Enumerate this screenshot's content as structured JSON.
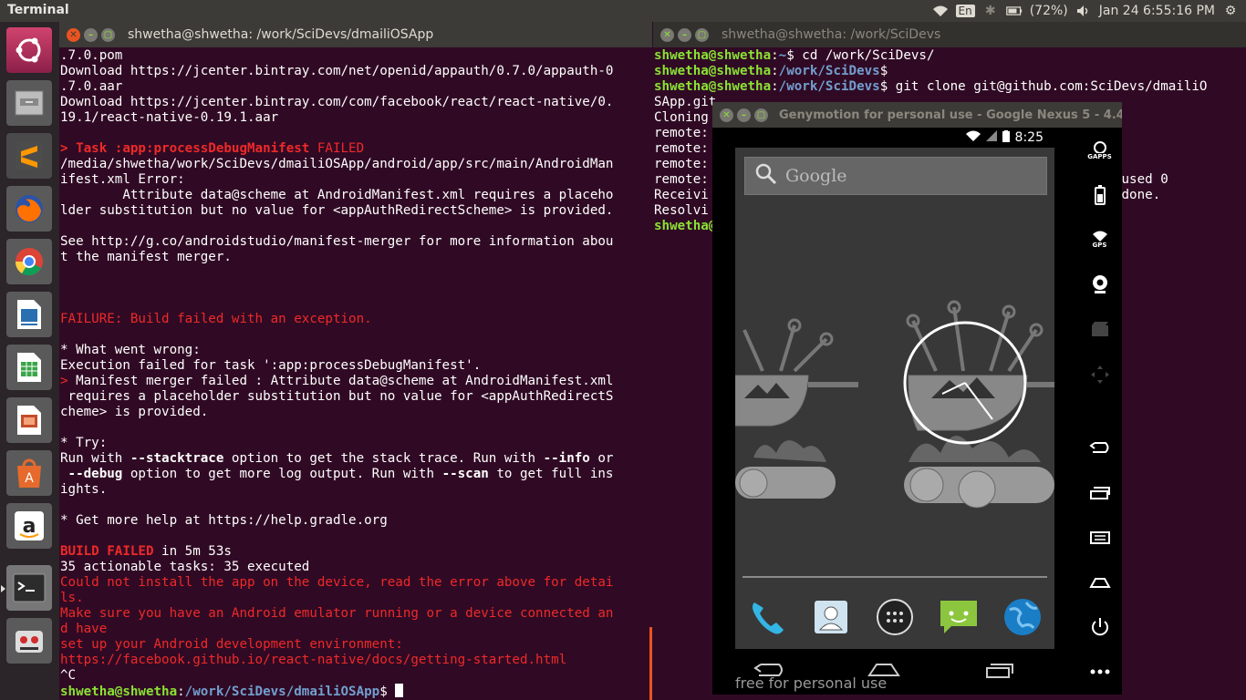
{
  "topbar": {
    "app_title": "Terminal",
    "lang": "En",
    "battery": "(72%)",
    "datetime": "Jan 24  6:55:16 PM"
  },
  "launcher": {
    "items": [
      {
        "name": "ubuntu-dash-icon",
        "color": "#c0335f"
      },
      {
        "name": "files-icon",
        "color": "#8a8a8a"
      },
      {
        "name": "sublime-text-icon",
        "color": "#3e3e3e"
      },
      {
        "name": "firefox-icon",
        "color": "#e66000"
      },
      {
        "name": "chrome-icon",
        "color": "#4285f4"
      },
      {
        "name": "libreoffice-writer-icon",
        "color": "#2a6fb0"
      },
      {
        "name": "libreoffice-calc-icon",
        "color": "#3aa548"
      },
      {
        "name": "libreoffice-impress-icon",
        "color": "#c44d2a"
      },
      {
        "name": "software-center-icon",
        "color": "#e66a2c"
      },
      {
        "name": "amazon-icon",
        "color": "#ffffff"
      },
      {
        "name": "terminal-icon",
        "color": "#2c2c2c"
      },
      {
        "name": "genymotion-icon",
        "color": "#d02c2c"
      }
    ]
  },
  "left_terminal": {
    "title": "shwetha@shwetha: /work/SciDevs/dmailiOSApp",
    "lines": [
      [
        {
          "c": "w",
          "t": ".7.0.pom"
        }
      ],
      [
        {
          "c": "w",
          "t": "Download https://jcenter.bintray.com/net/openid/appauth/0.7.0/appauth-0"
        }
      ],
      [
        {
          "c": "w",
          "t": ".7.0.aar"
        }
      ],
      [
        {
          "c": "w",
          "t": "Download https://jcenter.bintray.com/com/facebook/react/react-native/0."
        }
      ],
      [
        {
          "c": "w",
          "t": "19.1/react-native-0.19.1.aar"
        }
      ],
      [
        {
          "c": "w",
          "t": ""
        }
      ],
      [
        {
          "c": "rb",
          "t": "> Task :app:processDebugManifest"
        },
        {
          "c": "r",
          "t": " FAILED"
        }
      ],
      [
        {
          "c": "w",
          "t": "/media/shwetha/work/SciDevs/dmailiOSApp/android/app/src/main/AndroidMan"
        }
      ],
      [
        {
          "c": "w",
          "t": "ifest.xml Error:"
        }
      ],
      [
        {
          "c": "w",
          "t": "        Attribute data@scheme at AndroidManifest.xml requires a placeho"
        }
      ],
      [
        {
          "c": "w",
          "t": "lder substitution but no value for <appAuthRedirectScheme> is provided."
        }
      ],
      [
        {
          "c": "w",
          "t": ""
        }
      ],
      [
        {
          "c": "w",
          "t": "See http://g.co/androidstudio/manifest-merger for more information abou"
        }
      ],
      [
        {
          "c": "w",
          "t": "t the manifest merger."
        }
      ],
      [
        {
          "c": "w",
          "t": ""
        }
      ],
      [
        {
          "c": "w",
          "t": ""
        }
      ],
      [
        {
          "c": "w",
          "t": ""
        }
      ],
      [
        {
          "c": "r",
          "t": "FAILURE: Build failed with an exception."
        }
      ],
      [
        {
          "c": "w",
          "t": ""
        }
      ],
      [
        {
          "c": "w",
          "t": "* What went wrong:"
        }
      ],
      [
        {
          "c": "w",
          "t": "Execution failed for task ':app:processDebugManifest'."
        }
      ],
      [
        {
          "c": "r",
          "t": ">"
        },
        {
          "c": "w",
          "t": " Manifest merger failed : Attribute data@scheme at AndroidManifest.xml"
        }
      ],
      [
        {
          "c": "w",
          "t": " requires a placeholder substitution but no value for <appAuthRedirectS"
        }
      ],
      [
        {
          "c": "w",
          "t": "cheme> is provided."
        }
      ],
      [
        {
          "c": "w",
          "t": ""
        }
      ],
      [
        {
          "c": "w",
          "t": "* Try:"
        }
      ],
      [
        {
          "c": "w",
          "t": "Run with "
        },
        {
          "c": "bw",
          "t": "--stacktrace"
        },
        {
          "c": "w",
          "t": " option to get the stack trace. Run with "
        },
        {
          "c": "bw",
          "t": "--info"
        },
        {
          "c": "w",
          "t": " or"
        }
      ],
      [
        {
          "c": "bw",
          "t": " --debug"
        },
        {
          "c": "w",
          "t": " option to get more log output. Run with "
        },
        {
          "c": "bw",
          "t": "--scan"
        },
        {
          "c": "w",
          "t": " to get full ins"
        }
      ],
      [
        {
          "c": "w",
          "t": "ights."
        }
      ],
      [
        {
          "c": "w",
          "t": ""
        }
      ],
      [
        {
          "c": "w",
          "t": "* Get more help at https://help.gradle.org"
        }
      ],
      [
        {
          "c": "w",
          "t": ""
        }
      ],
      [
        {
          "c": "rb",
          "t": "BUILD FAILED"
        },
        {
          "c": "w",
          "t": " in 5m 53s"
        }
      ],
      [
        {
          "c": "w",
          "t": "35 actionable tasks: 35 executed"
        }
      ],
      [
        {
          "c": "r",
          "t": "Could not install the app on the device, read the error above for detai"
        }
      ],
      [
        {
          "c": "r",
          "t": "ls."
        }
      ],
      [
        {
          "c": "r",
          "t": "Make sure you have an Android emulator running or a device connected an"
        }
      ],
      [
        {
          "c": "r",
          "t": "d have"
        }
      ],
      [
        {
          "c": "r",
          "t": "set up your Android development environment:"
        }
      ],
      [
        {
          "c": "r",
          "t": "https://facebook.github.io/react-native/docs/getting-started.html"
        }
      ],
      [
        {
          "c": "w",
          "t": "^C"
        }
      ],
      [
        {
          "c": "g",
          "t": "shwetha@shwetha"
        },
        {
          "c": "w",
          "t": ":"
        },
        {
          "c": "b",
          "t": "/work/SciDevs/dmailiOSApp"
        },
        {
          "c": "w",
          "t": "$ "
        }
      ]
    ]
  },
  "right_terminal": {
    "title": "shwetha@shwetha: /work/SciDevs",
    "lines": [
      [
        {
          "c": "g",
          "t": "shwetha@shwetha"
        },
        {
          "c": "w",
          "t": ":"
        },
        {
          "c": "b",
          "t": "~"
        },
        {
          "c": "w",
          "t": "$ cd /work/SciDevs/"
        }
      ],
      [
        {
          "c": "g",
          "t": "shwetha@shwetha"
        },
        {
          "c": "w",
          "t": ":"
        },
        {
          "c": "b",
          "t": "/work/SciDevs"
        },
        {
          "c": "w",
          "t": "$"
        }
      ],
      [
        {
          "c": "g",
          "t": "shwetha@shwetha"
        },
        {
          "c": "w",
          "t": ":"
        },
        {
          "c": "b",
          "t": "/work/SciDevs"
        },
        {
          "c": "w",
          "t": "$ git clone git@github.com:SciDevs/dmailiO"
        }
      ],
      [
        {
          "c": "w",
          "t": "SApp.git"
        }
      ],
      [
        {
          "c": "w",
          "t": "Cloning"
        }
      ],
      [
        {
          "c": "w",
          "t": "remote:"
        }
      ],
      [
        {
          "c": "w",
          "t": "remote:"
        }
      ],
      [
        {
          "c": "w",
          "t": "remote:"
        }
      ],
      [
        {
          "c": "w",
          "t": "remote:                                              pack-reused 0"
        }
      ],
      [
        {
          "c": "w",
          "t": "Receivi                                               iB/s, done."
        }
      ],
      [
        {
          "c": "w",
          "t": "Resolvi"
        }
      ],
      [
        {
          "c": "g",
          "t": "shwetha@"
        }
      ]
    ]
  },
  "genymotion": {
    "title": "Genymotion for personal use - Google Nexus 5 - 4.4",
    "time": "8:25",
    "search_label": "Google",
    "free_label": "free for personal use",
    "side_labels": {
      "gapps": "GAPPS",
      "gps": "GPS"
    }
  }
}
